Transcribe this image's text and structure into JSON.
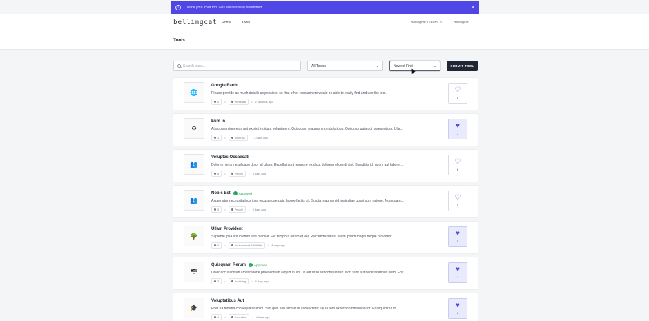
{
  "banner": {
    "message": "Thank you! Your tool was successfully submitted",
    "close": "×"
  },
  "nav": {
    "logo": "bellingcat",
    "links": [
      "Home",
      "Tools"
    ],
    "active": "Tools",
    "team_menu": "Bellingcat's Team",
    "user_menu": "Bellingcat"
  },
  "page": {
    "title": "Tools"
  },
  "filters": {
    "search_placeholder": "Search tools...",
    "topics_select": "All Topics",
    "sort_select": "Newest First",
    "submit_label": "SUBMIT TOOL"
  },
  "tools": [
    {
      "name": "Google Earth",
      "approved": false,
      "description": "Please provide as much details as possible, so that other researchers would be able to easily find and use the tool.",
      "comments": "0",
      "topic": "Websites",
      "time": "2 seconds ago",
      "votes": "0",
      "voted": false,
      "icon": "globe-icon",
      "glyph": "🌐"
    },
    {
      "name": "Eum In",
      "approved": false,
      "description": "At accusantium eius aut ex sint incidunt voluptatem. Quisquam magnam non doloribus. Qui dolor quia qui praesentium. Ulla...",
      "comments": "1",
      "topic": "Minerals",
      "time": "3 days ago",
      "votes": "7",
      "voted": true,
      "icon": "minerals-icon",
      "glyph": "⚙"
    },
    {
      "name": "Voluptas Occaecati",
      "approved": false,
      "description": "Dolorem rerum explicabo dolor sit ullam. Repellat sunt tempore ex dicta dolorem eligendi sint. Blanditiis id harum aut labore...",
      "comments": "8",
      "topic": "People",
      "time": "3 days ago",
      "votes": "6",
      "voted": false,
      "icon": "people-icon",
      "glyph": "👥"
    },
    {
      "name": "Nobis Est",
      "approved": true,
      "approved_label": "Approved",
      "description": "Aspernatur necessitatibus ipsa recusandae quia labore facilis sit. Soluta magnam id molestiae quasi sunt ratione. Numquam...",
      "comments": "3",
      "topic": "People",
      "time": "3 days ago",
      "votes": "5",
      "voted": false,
      "icon": "people-icon",
      "glyph": "👥"
    },
    {
      "name": "Ullam Provident",
      "approved": false,
      "description": "Sapiente ipsa voluptatum iure placeat. Est tempora rerum et vel. Reiciendis sit est ullam ipsam magni neque provident...",
      "comments": "0",
      "topic": "Environment & Wildlife",
      "time": "4 days ago",
      "votes": "5",
      "voted": true,
      "icon": "environment-icon",
      "glyph": "🌳"
    },
    {
      "name": "Quisquam Rerum",
      "approved": true,
      "approved_label": "Approved",
      "description": "Dolor accusantium amet ratione praesentium aliquid in illo. Ut aut sit id est consectetur. Non sunt aut necessitatibus iusto. Eos...",
      "comments": "3",
      "topic": "Archiving",
      "time": "4 days ago",
      "votes": "7",
      "voted": true,
      "icon": "archive-icon",
      "glyph": "🗃"
    },
    {
      "name": "Voluptatibus Aut",
      "approved": false,
      "description": "Et et ea mollitia consequatur enim. Sint quis non facere sit consectetur. Quia rem explicabo nihil incidunt. Et aliquid rerum...",
      "comments": "4",
      "topic": "Education",
      "time": "4 days ago",
      "votes": "8",
      "voted": true,
      "icon": "education-icon",
      "glyph": "🎓"
    }
  ]
}
